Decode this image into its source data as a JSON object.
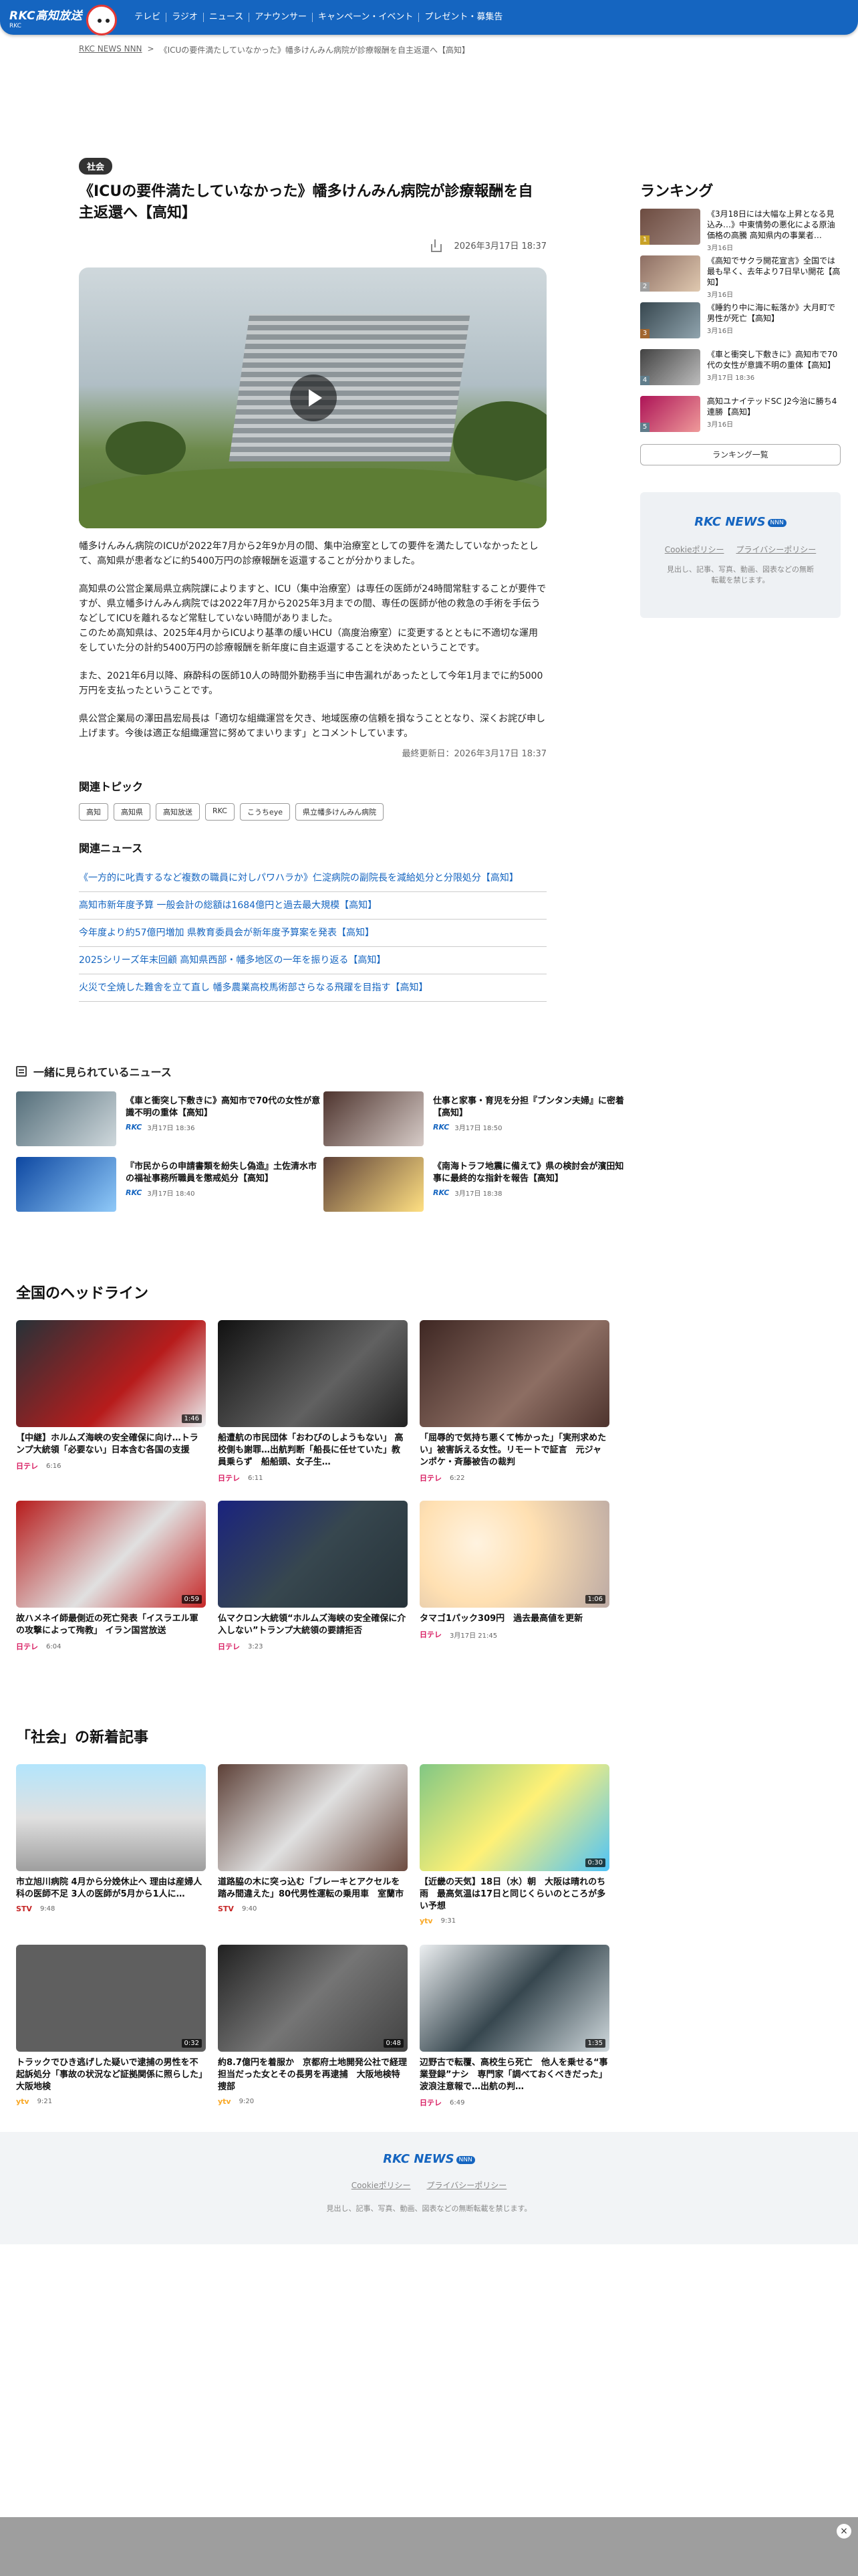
{
  "header": {
    "logo_text": "RKC高知放送",
    "logo_sub": "RKC",
    "nav": [
      "テレビ",
      "ラジオ",
      "ニュース",
      "アナウンサー",
      "キャンペーン・イベント",
      "プレゼント・募集告"
    ]
  },
  "breadcrumb": {
    "home": "RKC NEWS NNN",
    "sep": ">",
    "current": "《ICUの要件満たしていなかった》幡多けんみん病院が診療報酬を自主返還へ【高知】"
  },
  "article": {
    "category": "社会",
    "title": "《ICUの要件満たしていなかった》幡多けんみん病院が診療報酬を自主返還へ【高知】",
    "date": "2026年3月17日 18:37",
    "paragraphs": [
      "幡多けんみん病院のICUが2022年7月から2年9か月の間、集中治療室としての要件を満たしていなかったとして、高知県が患者などに約5400万円の診療報酬を返還することが分かりました。",
      "高知県の公営企業局県立病院課によりますと、ICU（集中治療室）は専任の医師が24時間常駐することが要件ですが、県立幡多けんみん病院では2022年7月から2025年3月までの間、専任の医師が他の救急の手術を手伝うなどしてICUを離れるなど常駐していない時間がありました。\nこのため高知県は、2025年4月からICUより基準の緩いHCU（高度治療室）に変更するとともに不適切な運用をしていた分の計約5400万円の診療報酬を新年度に自主返還することを決めたということです。",
      "また、2021年6月以降、麻酔科の医師10人の時間外勤務手当に申告漏れがあったとして今年1月までに約5000万円を支払ったということです。",
      "県公営企業局の澤田昌宏局長は「適切な組織運営を欠き、地域医療の信頼を損なうこととなり、深くお詫び申し上げます。今後は適正な組織運営に努めてまいります」とコメントしています。"
    ],
    "updated": "最終更新日：2026年3月17日 18:37"
  },
  "related_topics": {
    "heading": "関連トピック",
    "tags": [
      "高知",
      "高知県",
      "高知放送",
      "RKC",
      "こうちeye",
      "県立幡多けんみん病院"
    ]
  },
  "related_news": {
    "heading": "関連ニュース",
    "items": [
      "《一方的に叱責するなど複数の職員に対しパワハラか》仁淀病院の副院長を減給処分と分限処分【高知】",
      "高知市新年度予算 一般会計の総額は1684億円と過去最大規模【高知】",
      "今年度より約57億円増加 県教育委員会が新年度予算案を発表【高知】",
      "2025シリーズ年末回顧 高知県西部・幡多地区の一年を振り返る【高知】",
      "火災で全焼した難舎を立て直し 幡多農業高校馬術部さらなる飛躍を目指す【高知】"
    ]
  },
  "ranking": {
    "heading": "ランキング",
    "items": [
      {
        "title": "《3月18日には大幅な上昇となる見込み…》中東情勢の悪化による原油価格の高騰 高知県内の事業者…",
        "date": "3月16日"
      },
      {
        "title": "《高知でサクラ開花宣言》全国では最も早く、去年より7日早い開花【高知】",
        "date": "3月16日"
      },
      {
        "title": "《睡釣り中に海に転落か》大月町で男性が死亡【高知】",
        "date": "3月16日"
      },
      {
        "title": "《車と衝突し下敷きに》高知市で70代の女性が意識不明の重体【高知】",
        "date": "3月17日 18:36"
      },
      {
        "title": "高知ユナイテッドSC J2今治に勝ち4連勝【高知】",
        "date": "3月16日"
      }
    ],
    "more": "ランキング一覧"
  },
  "brand": {
    "name": "RKC NEWS",
    "badge": "NNN",
    "links": [
      "Cookieポリシー",
      "プライバシーポリシー"
    ],
    "note": "見出し、記事、写真、動画、図表などの無断転載を禁じます。"
  },
  "together": {
    "heading": "一緒に見られているニュース",
    "items": [
      {
        "title": "《車と衝突し下敷きに》高知市で70代の女性が意識不明の重体【高知】",
        "src": "RKC",
        "date": "3月17日 18:36"
      },
      {
        "title": "仕事と家事・育児を分担『ブンタン夫婦』に密着【高知】",
        "src": "RKC",
        "date": "3月17日 18:50"
      },
      {
        "title": "『市民からの申請書類を紛失し偽造』土佐清水市の福祉事務所職員を懲戒処分【高知】",
        "src": "RKC",
        "date": "3月17日 18:40"
      },
      {
        "title": "《南海トラフ地震に備えて》県の検討会が濱田知事に最終的な指針を報告【高知】",
        "src": "RKC",
        "date": "3月17日 18:38"
      }
    ]
  },
  "national": {
    "heading": "全国のヘッドライン",
    "items": [
      {
        "title": "【中継】ホルムズ海峡の安全確保に向け…トランプ大統領「必要ない」日本含む各国の支援",
        "src": "日テレ",
        "time": "6:16"
      },
      {
        "title": "船遭航の市民団体「おわびのしようもない」 高校側も謝罪…出航判断「船長に任せていた」教員乗らず　船船頭、女子生…",
        "src": "日テレ",
        "time": "6:11"
      },
      {
        "title": "「屈辱的で気持ち悪くて怖かった」「実刑求めたい」被害訴える女性。リモートで証言　元ジャンポケ・斉藤被告の裁判",
        "src": "日テレ",
        "time": "6:22"
      },
      {
        "title": "故ハメネイ師最側近の死亡発表「イスラエル軍の攻撃によって殉教」 イラン国営放送",
        "src": "日テレ",
        "time": "6:04"
      },
      {
        "title": "仏マクロン大統領“ホルムズ海峡の安全確保に介入しない”トランプ大統領の要請拒否",
        "src": "日テレ",
        "time": "3:23"
      },
      {
        "title": "タマゴ1パック309円　過去最高値を更新",
        "src": "日テレ",
        "time": "3月17日 21:45"
      }
    ],
    "durations": [
      "1:46",
      "",
      "",
      "0:59",
      "",
      "1:06"
    ]
  },
  "society": {
    "heading": "「社会」の新着記事",
    "items": [
      {
        "title": "市立旭川病院 4月から分娩休止へ 理由は産婦人科の医師不足 3人の医師が5月から1人に…",
        "src": "STV",
        "time": "9:48"
      },
      {
        "title": "道路脇の木に突っ込む「ブレーキとアクセルを踏み間違えた」80代男性運転の乗用車　室蘭市",
        "src": "STV",
        "time": "9:40"
      },
      {
        "title": "【近畿の天気】18日（水）朝　大阪は晴れのち雨　最高気温は17日と同じくらいのところが多い予想",
        "src": "ytv",
        "time": "9:31"
      },
      {
        "title": "トラックでひき逃げした疑いで逮捕の男性を不起訴処分「事故の状況など証拠関係に照らした」大阪地検",
        "src": "ytv",
        "time": "9:21"
      },
      {
        "title": "約8.7億円を着服か　京都府土地開発公社で経理担当だった女とその長男を再逮捕　大阪地検特捜部",
        "src": "ytv",
        "time": "9:20"
      },
      {
        "title": "辺野古で転覆、高校生ら死亡　他人を乗せる“事業登録”ナシ　専門家「調べておくべきだった」 波浪注意報で…出航の判…",
        "src": "日テレ",
        "time": "6:49"
      }
    ],
    "durations": [
      "",
      "",
      "0:30",
      "0:32",
      "0:48",
      "1:35"
    ]
  },
  "colors": {
    "header_blue": "#1565c0",
    "link_blue": "#1565c0",
    "ntv_pink": "#d81b60",
    "stv_red": "#c62828",
    "ytv_yellow": "#f9a825"
  },
  "icons": {
    "share": "share-icon",
    "play": "play-icon",
    "list": "list-icon",
    "close": "close-icon"
  },
  "ad": {
    "close": "×"
  }
}
